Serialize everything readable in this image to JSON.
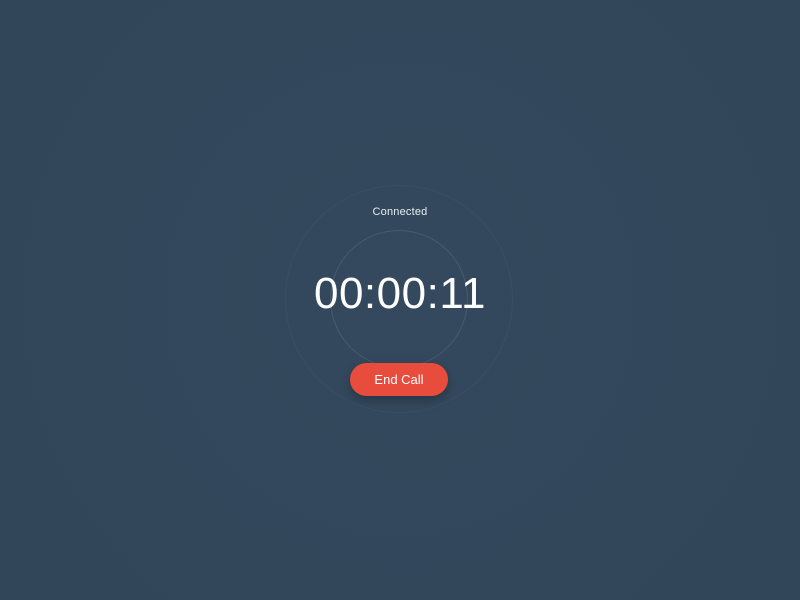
{
  "call": {
    "status": "Connected",
    "timer": "00:00:11",
    "end_call_label": "End Call"
  },
  "colors": {
    "background": "#33475b",
    "end_call_button": "#e74c3c",
    "text": "#ffffff"
  }
}
